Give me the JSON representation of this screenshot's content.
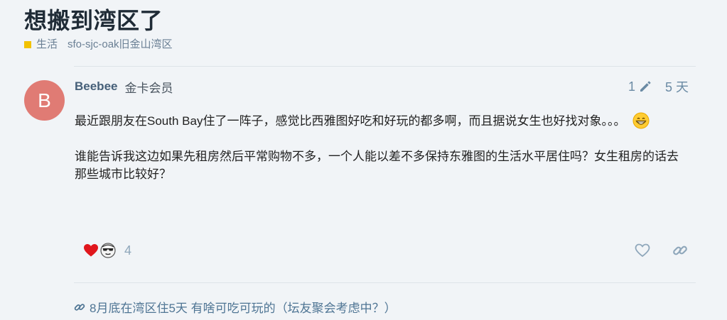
{
  "topic": {
    "title": "想搬到湾区了",
    "category": {
      "label": "生活",
      "color": "#f2c200"
    },
    "tag": "sfo-sjc-oak旧金山湾区"
  },
  "post": {
    "avatar_letter": "B",
    "avatar_color": "#e07b74",
    "username": "Beebee",
    "user_title": "金卡会员",
    "edit_count": "1",
    "date": "5 天",
    "paragraph_1": "最近跟朋友在South Bay住了一阵子，感觉比西雅图好吃和好玩的都多啊，而且据说女生也好找对象。。。",
    "paragraph_2": "谁能告诉我这边如果先租房然后平常购物不多，一个人能以差不多保持东雅图的生活水平居住吗？女生租房的话去那些城市比较好？",
    "reactions": {
      "icons": [
        "heart-icon",
        "sunglasses-face-icon"
      ],
      "count": "4"
    }
  },
  "linked_topic": {
    "title": "8月底在湾区住5天 有啥可吃可玩的（坛友聚会考虑中？）"
  },
  "colors": {
    "background": "#f1f4f7",
    "title": "#1f2b36",
    "link": "#4f7594",
    "muted": "#6a8aa4"
  }
}
